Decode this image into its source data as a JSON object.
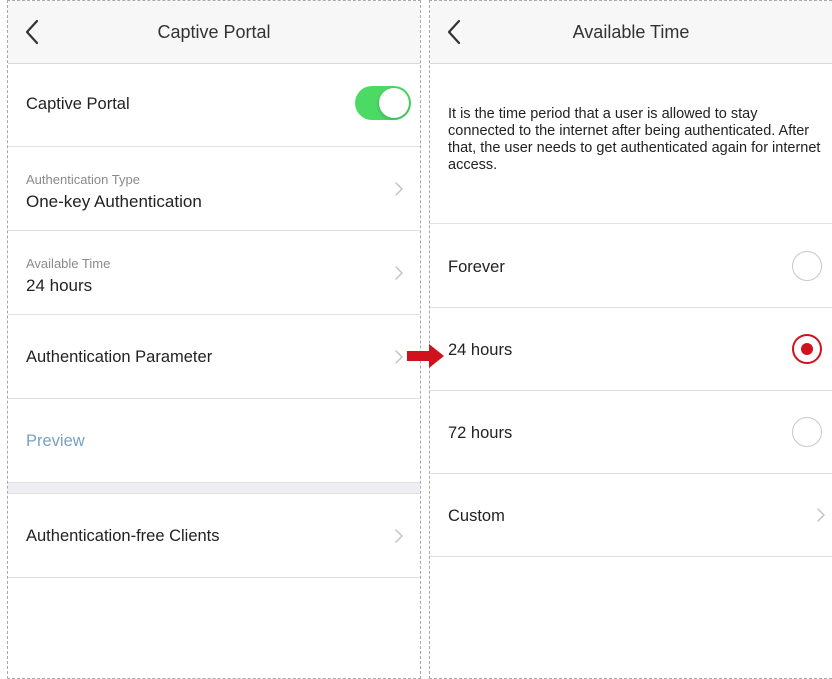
{
  "left_screen": {
    "nav": {
      "title": "Captive Portal"
    },
    "captive_portal": {
      "label": "Captive Portal",
      "enabled": true
    },
    "authentication_type": {
      "label": "Authentication Type",
      "value": "One-key Authentication"
    },
    "available_time": {
      "label": "Available Time",
      "value": "24 hours"
    },
    "authentication_parameter": {
      "label": "Authentication Parameter"
    },
    "preview": {
      "label": "Preview"
    },
    "authentication_free_clients": {
      "label": "Authentication-free Clients"
    }
  },
  "right_screen": {
    "nav": {
      "title": "Available Time"
    },
    "description": "It is the time period that a user is allowed to stay connected to the internet after being authenticated. After that, the user needs to get authenticated again for internet access.",
    "options": [
      {
        "label": "Forever",
        "selected": false
      },
      {
        "label": "24 hours",
        "selected": true
      },
      {
        "label": "72 hours",
        "selected": false
      },
      {
        "label": "Custom",
        "selected": false
      }
    ]
  },
  "icons": {
    "back": "chevron-left-icon",
    "chevron": "chevron-right-icon",
    "arrow": "right-arrow-icon"
  },
  "colors": {
    "toggle_on": "#4cd964",
    "radio_selected": "#d0121c",
    "link": "#7a9fc4",
    "arrow": "#d0121c",
    "nav_background": "#f7f7f7"
  }
}
